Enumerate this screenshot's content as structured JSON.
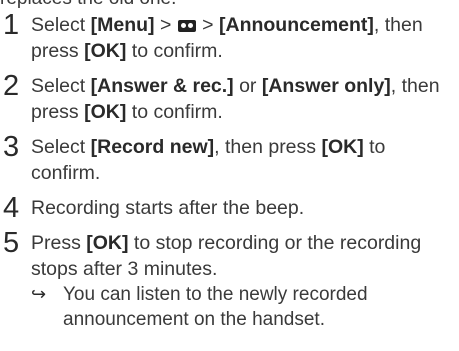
{
  "intro_text": "replaces the old one.",
  "steps": [
    {
      "number": "1",
      "pre": "Select ",
      "kw1": "[Menu]",
      "mid1": " > ",
      "icon": "tape-icon",
      "mid2": " > ",
      "kw2": "[Announcement]",
      "post": ", then press ",
      "kw3": "[OK]",
      "end": " to confirm."
    },
    {
      "number": "2",
      "pre": "Select ",
      "kw1": "[Answer & rec.]",
      "mid1": " or ",
      "kw2": "[Answer only]",
      "post": ", then press ",
      "kw3": "[OK]",
      "end": " to confirm."
    },
    {
      "number": "3",
      "pre": "Select ",
      "kw1": "[Record new]",
      "post": ", then press ",
      "kw3": "[OK]",
      "end": " to confirm."
    },
    {
      "number": "4",
      "text": "Recording starts after the beep."
    },
    {
      "number": "5",
      "pre": "Press ",
      "kw1": "[OK]",
      "end": " to stop recording or the recording stops after 3 minutes.",
      "result_arrow": "↪",
      "result_text": "You can listen to the newly recorded announcement on the handset."
    }
  ]
}
